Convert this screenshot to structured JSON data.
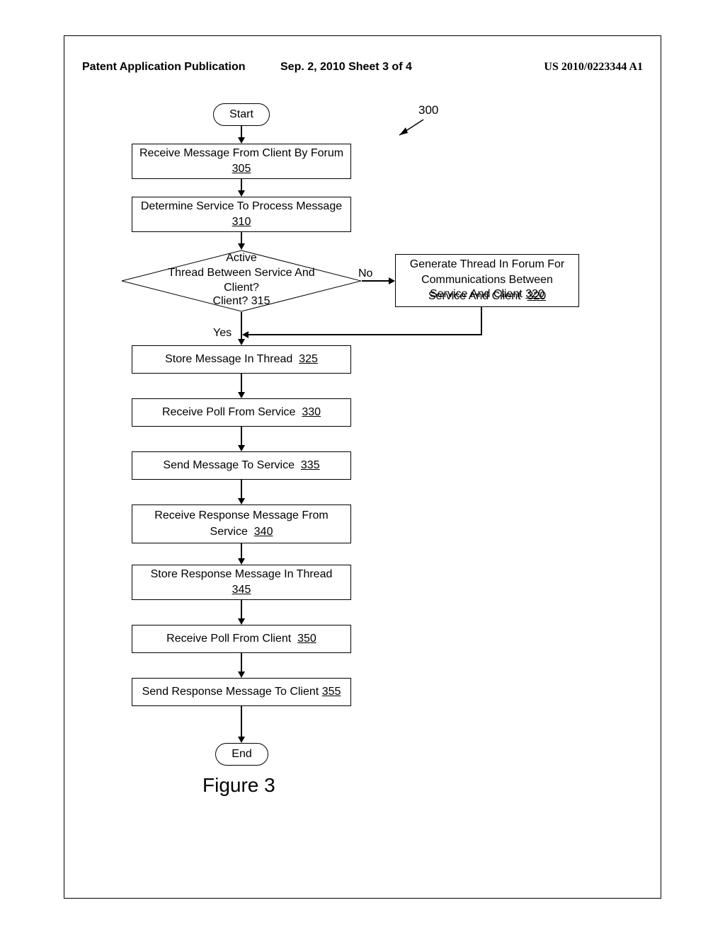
{
  "header": {
    "left": "Patent Application Publication",
    "center": "Sep. 2, 2010  Sheet 3 of 4",
    "right": "US 2010/0223344 A1"
  },
  "figure_number": "300",
  "figure_caption": "Figure 3",
  "terminators": {
    "start": "Start",
    "end": "End"
  },
  "steps": {
    "s305": {
      "text": "Receive Message From Client By Forum",
      "ref": "305"
    },
    "s310": {
      "text": "Determine Service To Process Message",
      "ref": "310"
    },
    "s315": {
      "text": "Active\nThread Between Service And\nClient?",
      "ref": "315"
    },
    "s320": {
      "text": "Generate Thread In Forum For\nCommunications Between\nService And Client",
      "ref": "320"
    },
    "s325": {
      "text": "Store Message In Thread",
      "ref": "325"
    },
    "s330": {
      "text": "Receive Poll From Service",
      "ref": "330"
    },
    "s335": {
      "text": "Send Message To Service",
      "ref": "335"
    },
    "s340": {
      "text": "Receive Response Message From\nService",
      "ref": "340"
    },
    "s345": {
      "text": "Store Response Message In Thread",
      "ref": "345"
    },
    "s350": {
      "text": "Receive Poll From Client",
      "ref": "350"
    },
    "s355": {
      "text": "Send Response Message To Client",
      "ref": "355"
    }
  },
  "edges": {
    "yes": "Yes",
    "no": "No"
  }
}
